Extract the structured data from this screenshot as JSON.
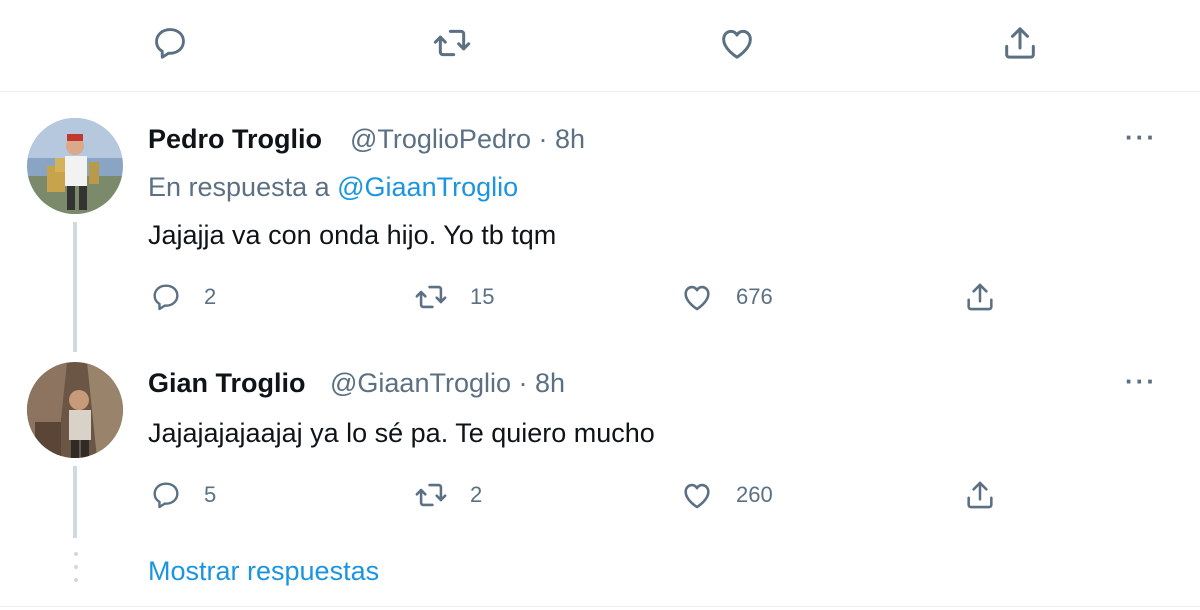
{
  "top_actions": {
    "reply_icon": "reply-icon",
    "retweet_icon": "retweet-icon",
    "like_icon": "like-icon",
    "share_icon": "share-icon"
  },
  "tweets": [
    {
      "name": "Pedro Troglio",
      "handle": "@TroglioPedro",
      "time": "8h",
      "meta": "@TroglioPedro · 8h",
      "reply_prefix": "En respuesta a ",
      "reply_mention": "@GiaanTroglio",
      "text": "Jajajja va con onda hijo. Yo tb tqm",
      "replies": "2",
      "retweets": "15",
      "likes": "676",
      "more_label": "···"
    },
    {
      "name": "Gian Troglio",
      "handle": "@GiaanTroglio",
      "time": "8h",
      "meta": "@GiaanTroglio · 8h",
      "text": "Jajajajajaajaj ya lo sé pa. Te quiero mucho",
      "replies": "5",
      "retweets": "2",
      "likes": "260",
      "more_label": "···"
    }
  ],
  "show_replies": "Mostrar respuestas",
  "colors": {
    "text": "#0f1419",
    "secondary": "#5b7083",
    "link": "#1b95e0",
    "divider": "#ebeef0",
    "thread_line": "#cfd9de"
  }
}
